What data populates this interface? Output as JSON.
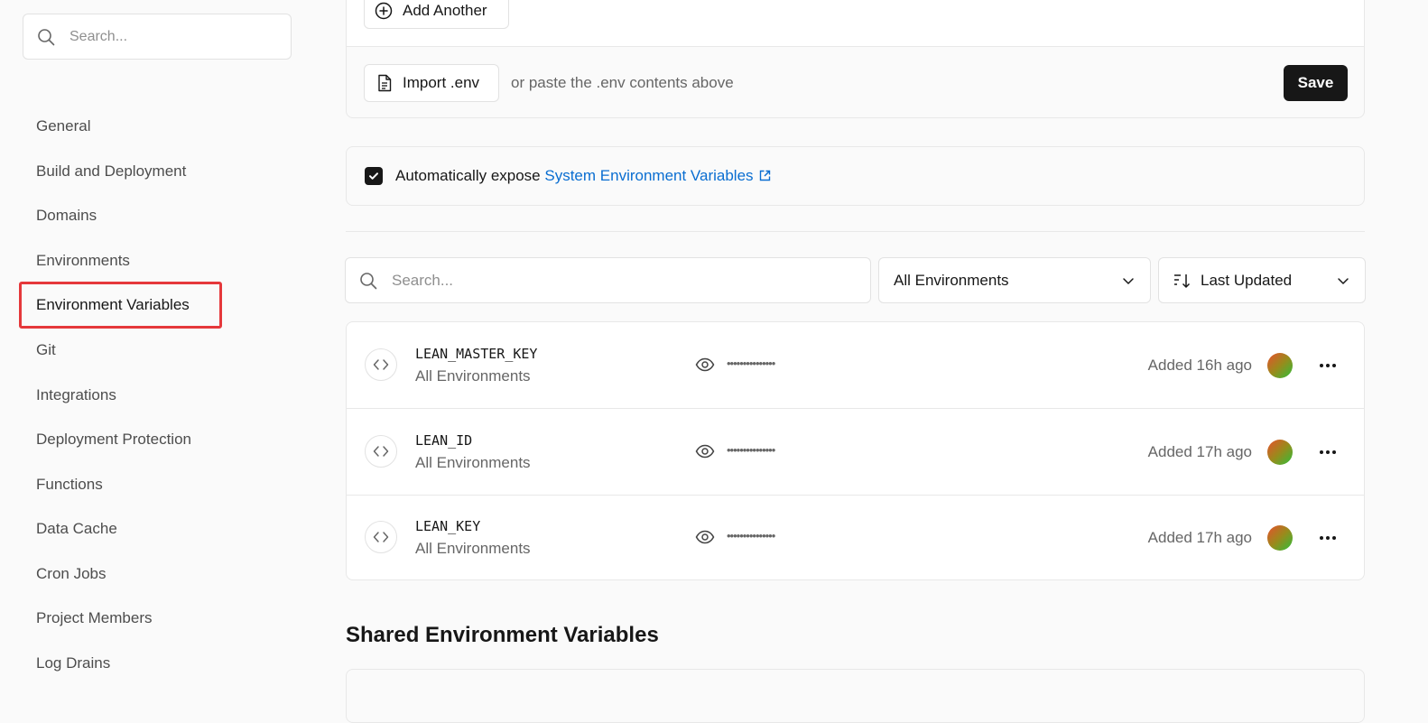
{
  "sidebar": {
    "search_placeholder": "Search...",
    "items": [
      {
        "label": "General"
      },
      {
        "label": "Build and Deployment"
      },
      {
        "label": "Domains"
      },
      {
        "label": "Environments"
      },
      {
        "label": "Environment Variables",
        "active": true
      },
      {
        "label": "Git"
      },
      {
        "label": "Integrations"
      },
      {
        "label": "Deployment Protection"
      },
      {
        "label": "Functions"
      },
      {
        "label": "Data Cache"
      },
      {
        "label": "Cron Jobs"
      },
      {
        "label": "Project Members"
      },
      {
        "label": "Log Drains"
      }
    ]
  },
  "editor": {
    "add_another_label": "Add Another",
    "import_label": "Import .env",
    "paste_hint": "or paste the .env contents above",
    "save_label": "Save"
  },
  "expose": {
    "checked": true,
    "text": "Automatically expose",
    "link_text": "System Environment Variables"
  },
  "filters": {
    "search_placeholder": "Search...",
    "environment_selected": "All Environments",
    "sort_selected": "Last Updated"
  },
  "variables": [
    {
      "name": "LEAN_MASTER_KEY",
      "environment": "All Environments",
      "masked_value": "•••••••••••••••",
      "added": "Added 16h ago"
    },
    {
      "name": "LEAN_ID",
      "environment": "All Environments",
      "masked_value": "•••••••••••••••",
      "added": "Added 17h ago"
    },
    {
      "name": "LEAN_KEY",
      "environment": "All Environments",
      "masked_value": "•••••••••••••••",
      "added": "Added 17h ago"
    }
  ],
  "shared": {
    "title": "Shared Environment Variables"
  },
  "colors": {
    "accent_link": "#0a6ed1",
    "highlight_border": "#e5383b",
    "save_button": "#171717"
  }
}
